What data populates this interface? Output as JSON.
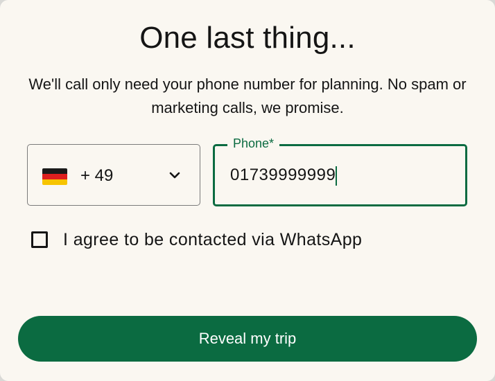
{
  "header": {
    "title": "One last thing...",
    "subtitle": "We'll call only need your phone number for planning. No spam or marketing calls, we promise."
  },
  "country_select": {
    "flag_icon": "germany-flag-icon",
    "dial_code": "+ 49",
    "chevron_icon": "chevron-down-icon"
  },
  "phone": {
    "label": "Phone*",
    "value": "01739999999"
  },
  "consent": {
    "checked": false,
    "label": "I agree to be contacted via WhatsApp"
  },
  "cta": {
    "label": "Reveal my trip"
  },
  "colors": {
    "accent": "#0b6b41",
    "background": "#faf7f1",
    "text": "#151515"
  }
}
